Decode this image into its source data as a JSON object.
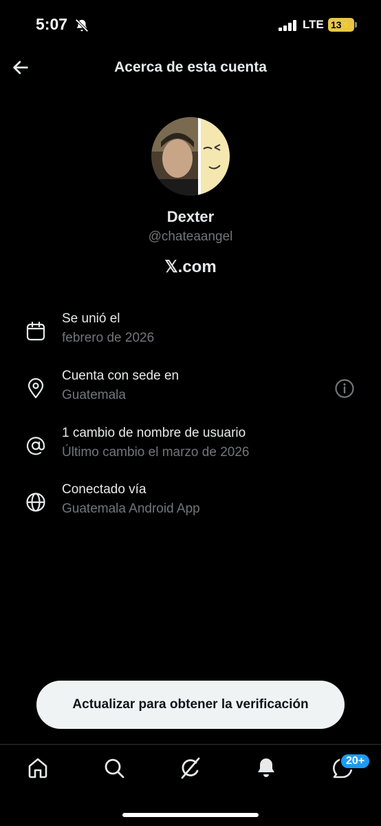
{
  "status_bar": {
    "time": "5:07",
    "network": "LTE",
    "battery": "13",
    "icons": [
      "bell-off-icon",
      "signal-icon",
      "battery-icon"
    ]
  },
  "header": {
    "title": "Acerca de esta cuenta",
    "back_icon": "arrow-left-icon"
  },
  "profile": {
    "name": "Dexter",
    "handle": "@chateaangel",
    "domain": "𝕏.com"
  },
  "info": [
    {
      "icon": "calendar-icon",
      "title": "Se unió el",
      "subtitle": "febrero de 2026"
    },
    {
      "icon": "location-pin-icon",
      "title": "Cuenta con sede en",
      "subtitle": "Guatemala",
      "action_icon": "info-icon"
    },
    {
      "icon": "at-sign-icon",
      "title": "1 cambio de nombre de usuario",
      "subtitle": "Último cambio el marzo de 2026"
    },
    {
      "icon": "globe-icon",
      "title": "Conectado vía",
      "subtitle": "Guatemala Android App"
    }
  ],
  "cta": {
    "label": "Actualizar para obtener la verificación"
  },
  "nav": {
    "items": [
      "home-icon",
      "search-icon",
      "grok-icon",
      "notifications-icon",
      "messages-icon"
    ],
    "messages_badge": "20+"
  },
  "colors": {
    "background": "#000000",
    "primary_text": "#e7e9ea",
    "secondary_text": "#71767b",
    "badge": "#1d9bf0",
    "battery": "#e8c64a"
  }
}
